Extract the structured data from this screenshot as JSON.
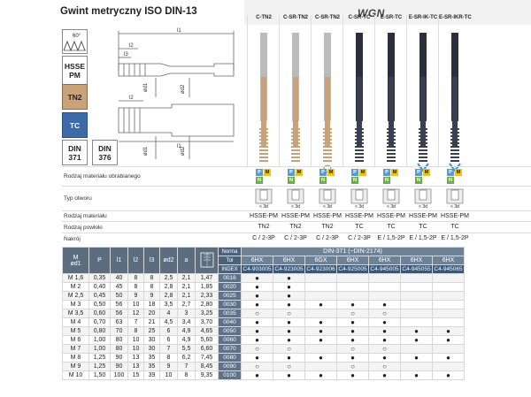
{
  "header": {
    "title": "Gwint metryczny ISO DIN-13",
    "brand": "WGN"
  },
  "badges": {
    "hsse": [
      "HSSE",
      "PM"
    ],
    "tn2": "TN2",
    "tc": "TC",
    "din1": [
      "DIN",
      "371"
    ],
    "din2": [
      "DIN",
      "376"
    ],
    "angle": "60°",
    "thread_icon": "thread-profile-icon"
  },
  "drawing": {
    "labels": [
      "l1",
      "l2",
      "l3",
      "ød1",
      "ød2",
      "ød1",
      "ød2",
      "l2",
      "l1"
    ]
  },
  "tools": [
    {
      "name": "C-TN2",
      "color": "#c9a27a"
    },
    {
      "name": "C-SR-TN2",
      "color": "#c9a27a"
    },
    {
      "name": "C-SR-TN2",
      "color": "#c9a27a"
    },
    {
      "name": "C-SR-TC",
      "color": "#3b3f52"
    },
    {
      "name": "E-SR-TC",
      "color": "#3b3f52"
    },
    {
      "name": "E-SR-IK-TC",
      "color": "#3b3f52"
    },
    {
      "name": "E-SR-IKR-TC",
      "color": "#3b3f52"
    }
  ],
  "properties": {
    "material_label": "Rodzaj materiału obrabianego",
    "hole_label": "Typ otworu",
    "material_type_label": "Rodzaj materiału",
    "coating_label": "Rodzaj powłoki",
    "chamfer_label": "Nakrój",
    "hole_depths": [
      "< 3d",
      "< 3d",
      "< 3d",
      "< 3d",
      "< 3d",
      "< 3d",
      "< 3d"
    ],
    "material_types": [
      "HSSE-PM",
      "HSSE-PM",
      "HSSE-PM",
      "HSSE-PM",
      "HSSE-PM",
      "HSSE-PM",
      "HSSE-PM"
    ],
    "coatings": [
      "TN2",
      "TN2",
      "TN2",
      "TC",
      "TC",
      "TC",
      "TC"
    ],
    "chamfers": [
      "C / 2-3P",
      "C / 2-3P",
      "C / 2-3P",
      "C / 2-3P",
      "E / 1,5-2P",
      "E / 1,5-2P",
      "E / 1,5-2P"
    ],
    "iso_groups": [
      "P",
      "M",
      "N"
    ]
  },
  "table": {
    "col_headers": [
      "M\nød1",
      "P",
      "l1",
      "l2",
      "l3",
      "ød2",
      "a"
    ],
    "norma_label": "Norma",
    "norma_value": "DIN-371 (~DIN-2174)",
    "tol_label": "Tol",
    "tolerances": [
      "6HX",
      "6HX",
      "6GX",
      "6HX",
      "6HX",
      "6HX",
      "6HX"
    ],
    "index_label": "INDEX",
    "codes": [
      "C4-903005",
      "C4-923005",
      "C4-923006",
      "C4-925005",
      "C4-945005",
      "C4-945055",
      "C4-945065"
    ],
    "rows": [
      {
        "m": "M 1,6",
        "p": "0,35",
        "l1": "40",
        "l2": "8",
        "l3": "8",
        "d2": "2,5",
        "a": "2,1",
        "dr": "1,47",
        "idx": "0016",
        "marks": [
          "●",
          "●",
          "",
          "",
          "",
          "",
          ""
        ]
      },
      {
        "m": "M 2",
        "p": "0,40",
        "l1": "45",
        "l2": "8",
        "l3": "8",
        "d2": "2,8",
        "a": "2,1",
        "dr": "1,85",
        "idx": "0020",
        "marks": [
          "●",
          "●",
          "",
          "",
          "",
          "",
          ""
        ]
      },
      {
        "m": "M 2,5",
        "p": "0,45",
        "l1": "50",
        "l2": "9",
        "l3": "9",
        "d2": "2,8",
        "a": "2,1",
        "dr": "2,33",
        "idx": "0025",
        "marks": [
          "●",
          "●",
          "",
          "",
          "",
          "",
          ""
        ]
      },
      {
        "m": "M 3",
        "p": "0,50",
        "l1": "56",
        "l2": "10",
        "l3": "18",
        "d2": "3,5",
        "a": "2,7",
        "dr": "2,80",
        "idx": "0030",
        "marks": [
          "●",
          "●",
          "●",
          "●",
          "●",
          "",
          ""
        ]
      },
      {
        "m": "M 3,5",
        "p": "0,60",
        "l1": "56",
        "l2": "12",
        "l3": "20",
        "d2": "4",
        "a": "3",
        "dr": "3,25",
        "idx": "0035",
        "marks": [
          "○",
          "○",
          "",
          "○",
          "○",
          "",
          ""
        ]
      },
      {
        "m": "M 4",
        "p": "0,70",
        "l1": "63",
        "l2": "7",
        "l3": "21",
        "d2": "4,5",
        "a": "3,4",
        "dr": "3,70",
        "idx": "0040",
        "marks": [
          "●",
          "●",
          "●",
          "●",
          "●",
          "",
          ""
        ]
      },
      {
        "m": "M 5",
        "p": "0,80",
        "l1": "70",
        "l2": "8",
        "l3": "25",
        "d2": "6",
        "a": "4,9",
        "dr": "4,65",
        "idx": "0050",
        "marks": [
          "●",
          "●",
          "●",
          "●",
          "●",
          "●",
          "●"
        ]
      },
      {
        "m": "M 6",
        "p": "1,00",
        "l1": "80",
        "l2": "10",
        "l3": "30",
        "d2": "6",
        "a": "4,9",
        "dr": "5,60",
        "idx": "0060",
        "marks": [
          "●",
          "●",
          "●",
          "●",
          "●",
          "●",
          "●"
        ]
      },
      {
        "m": "M 7",
        "p": "1,00",
        "l1": "80",
        "l2": "10",
        "l3": "30",
        "d2": "7",
        "a": "5,5",
        "dr": "6,60",
        "idx": "0070",
        "marks": [
          "○",
          "○",
          "",
          "○",
          "○",
          "",
          ""
        ]
      },
      {
        "m": "M 8",
        "p": "1,25",
        "l1": "90",
        "l2": "13",
        "l3": "35",
        "d2": "8",
        "a": "6,2",
        "dr": "7,45",
        "idx": "0080",
        "marks": [
          "●",
          "●",
          "●",
          "●",
          "●",
          "●",
          "●"
        ]
      },
      {
        "m": "M 9",
        "p": "1,25",
        "l1": "90",
        "l2": "13",
        "l3": "35",
        "d2": "9",
        "a": "7",
        "dr": "8,45",
        "idx": "0090",
        "marks": [
          "○",
          "○",
          "",
          "○",
          "○",
          "",
          ""
        ]
      },
      {
        "m": "M 10",
        "p": "1,50",
        "l1": "100",
        "l2": "15",
        "l3": "39",
        "d2": "10",
        "a": "8",
        "dr": "9,35",
        "idx": "0100",
        "marks": [
          "●",
          "●",
          "●",
          "●",
          "●",
          "●",
          "●"
        ]
      }
    ]
  }
}
